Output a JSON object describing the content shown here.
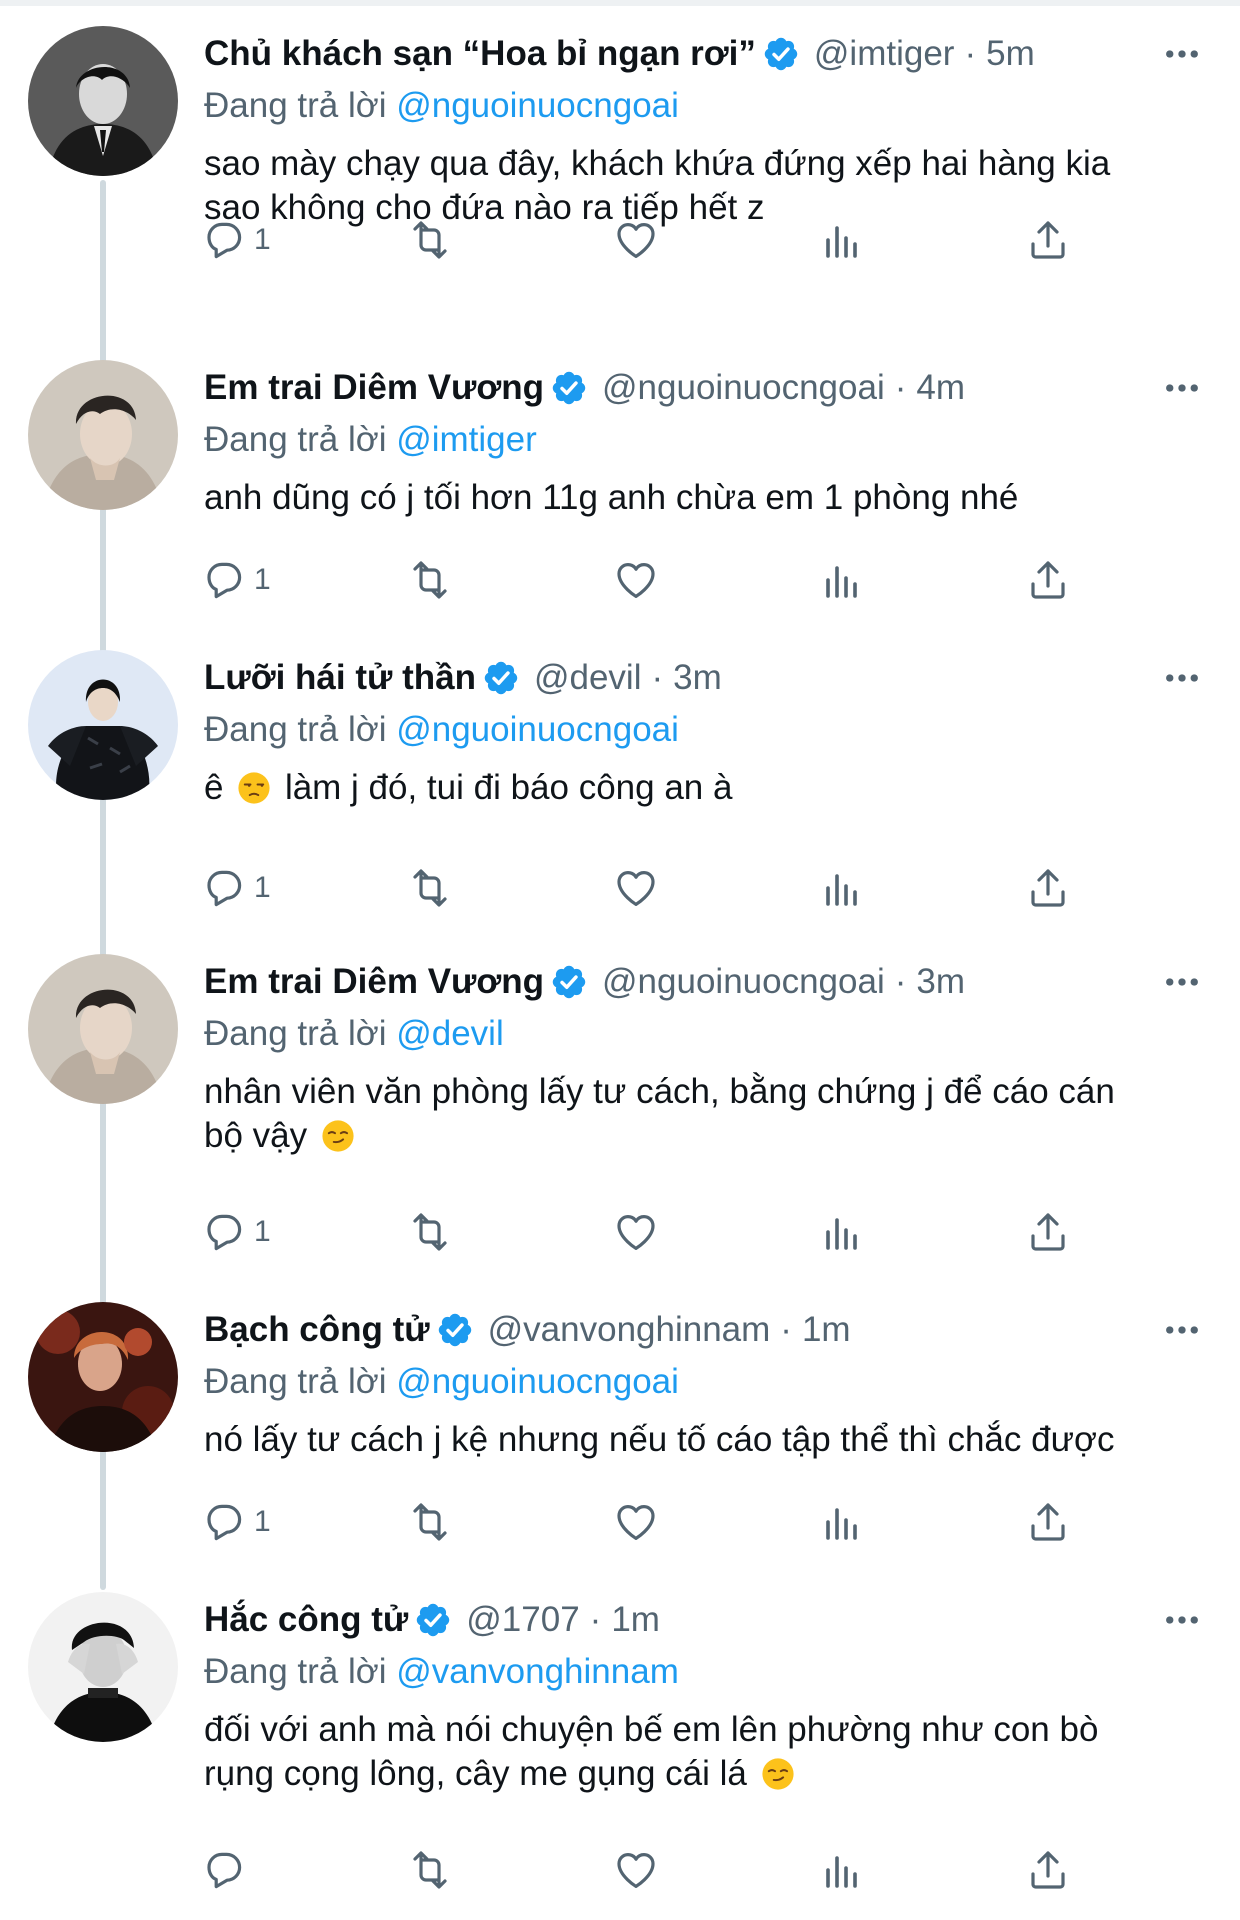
{
  "reply_prefix": "Đang trả lời",
  "colors": {
    "accent": "#1d9bf0",
    "muted": "#536471",
    "text": "#0f1419",
    "thread_line": "#cfd9de"
  },
  "tweets": [
    {
      "name": "Chủ khách sạn “Hoa bỉ ngạn rơi”",
      "handle": "@imtiger",
      "time": "5m",
      "replying_to": "@nguoinuocngoai",
      "text": "sao mày chạy qua đây, khách khứa đứng xếp hai hàng kia\nsao không cho đứa nào ra tiếp hết z",
      "emoji_after": "",
      "reply_count": "1"
    },
    {
      "name": "Em trai Diêm Vương",
      "handle": "@nguoinuocngoai",
      "time": "4m",
      "replying_to": "@imtiger",
      "text": "anh dũng có j tối hơn 11g anh chừa em 1 phòng nhé",
      "emoji_after": "",
      "reply_count": "1"
    },
    {
      "name": "Lưỡi hái tử thần",
      "handle": "@devil",
      "time": "3m",
      "replying_to": "@nguoinuocngoai",
      "text_before_emoji": "ê",
      "text": "làm j đó, tui đi báo công an à",
      "emoji_before": "unamused-face-emoji",
      "reply_count": "1"
    },
    {
      "name": "Em trai Diêm Vương",
      "handle": "@nguoinuocngoai",
      "time": "3m",
      "replying_to": "@devil",
      "text": "nhân viên văn phòng lấy tư cách, bằng chứng j để cáo cán\nbộ vậy",
      "emoji_after": "smirking-face-emoji",
      "reply_count": "1"
    },
    {
      "name": "Bạch công tử",
      "handle": "@vanvonghinnam",
      "time": "1m",
      "replying_to": "@nguoinuocngoai",
      "text": "nó lấy tư cách j kệ nhưng nếu tố cáo tập thể thì chắc được",
      "emoji_after": "",
      "reply_count": "1"
    },
    {
      "name": "Hắc công tử",
      "handle": "@1707",
      "time": "1m",
      "replying_to": "@vanvonghinnam",
      "text": "đối với anh mà nói chuyện bế em lên phường như con bò\nrụng cọng lông, cây me gụng cái lá",
      "emoji_after": "smirking-face-emoji",
      "reply_count": ""
    }
  ]
}
